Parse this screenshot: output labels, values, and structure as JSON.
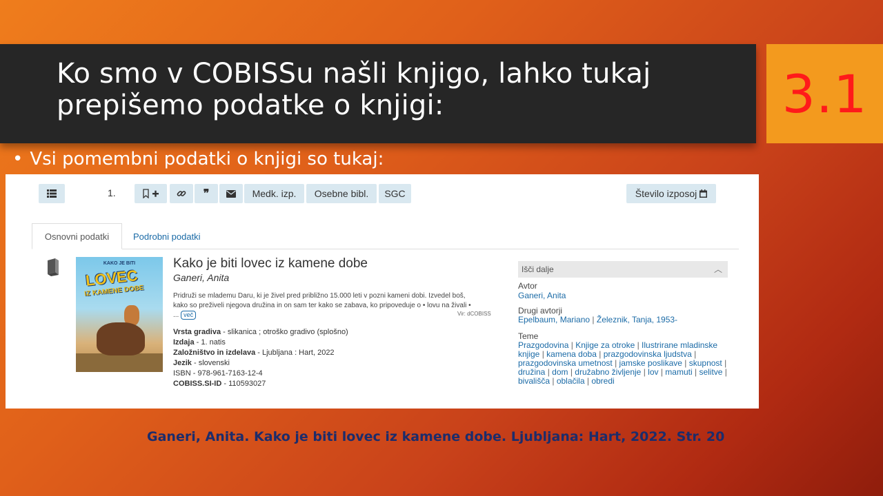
{
  "slide": {
    "title": "Ko smo v COBISSu našli knjigo, lahko tukaj prepišemo podatke o knjigi:",
    "badge": "3.1",
    "bullet": "Vsi pomembni podatki o knjigi so tukaj:",
    "citation": "Ganeri, Anita. Kako je biti lovec iz kamene dobe. Ljubljana: Hart, 2022. Str. 20"
  },
  "toolbar": {
    "row_number": "1.",
    "medk_label": "Medk. izp.",
    "osebne_label": "Osebne bibl.",
    "sgc_label": "SGC",
    "loans_label": "Število izposoj"
  },
  "tabs": {
    "basic": "Osnovni podatki",
    "detailed": "Podrobni podatki"
  },
  "book": {
    "title": "Kako je biti lovec iz kamene dobe",
    "author": "Ganeri, Anita",
    "description": "Pridruži se mlademu Daru, ki je živel pred približno 15.000 leti v pozni kameni dobi. Izvedel boš, kako so preživeli njegova družina in on sam ter kako se zabava, ko pripoveduje o • lovu na živali • ...",
    "more_label": "več",
    "source_note": "Vir: dCOBISS",
    "cover": {
      "top_line": "KAKO JE BITI",
      "big_word": "LOVEC",
      "sub_line": "IZ KAMENE DOBE"
    },
    "meta": [
      {
        "label": "Vrsta gradiva",
        "value": " - slikanica ; otroško gradivo (splošno)"
      },
      {
        "label": "Izdaja",
        "value": " - 1. natis"
      },
      {
        "label": "Založništvo in izdelava",
        "value": " - Ljubljana : Hart, 2022"
      },
      {
        "label": "Jezik",
        "value": " - slovenski"
      },
      {
        "label": "ISBN",
        "value": " - 978-961-7163-12-4"
      },
      {
        "label": "COBISS.SI-ID",
        "value": " - 110593027"
      }
    ]
  },
  "sidebar": {
    "heading": "Išči dalje",
    "author_label": "Avtor",
    "author_value": "Ganeri, Anita",
    "other_label": "Drugi avtorji",
    "other_authors": [
      "Epelbaum, Mariano",
      "Železnik, Tanja, 1953-"
    ],
    "topics_label": "Teme",
    "topics": [
      "Prazgodovina",
      "Knjige za otroke",
      "Ilustrirane mladinske knjige",
      "kamena doba",
      "prazgodovinska ljudstva",
      "prazgodovinska umetnost",
      "jamske poslikave",
      "skupnost",
      "družina",
      "dom",
      "družabno življenje",
      "lov",
      "mamuti",
      "selitve",
      "bivališča",
      "oblačila",
      "obredi"
    ]
  }
}
